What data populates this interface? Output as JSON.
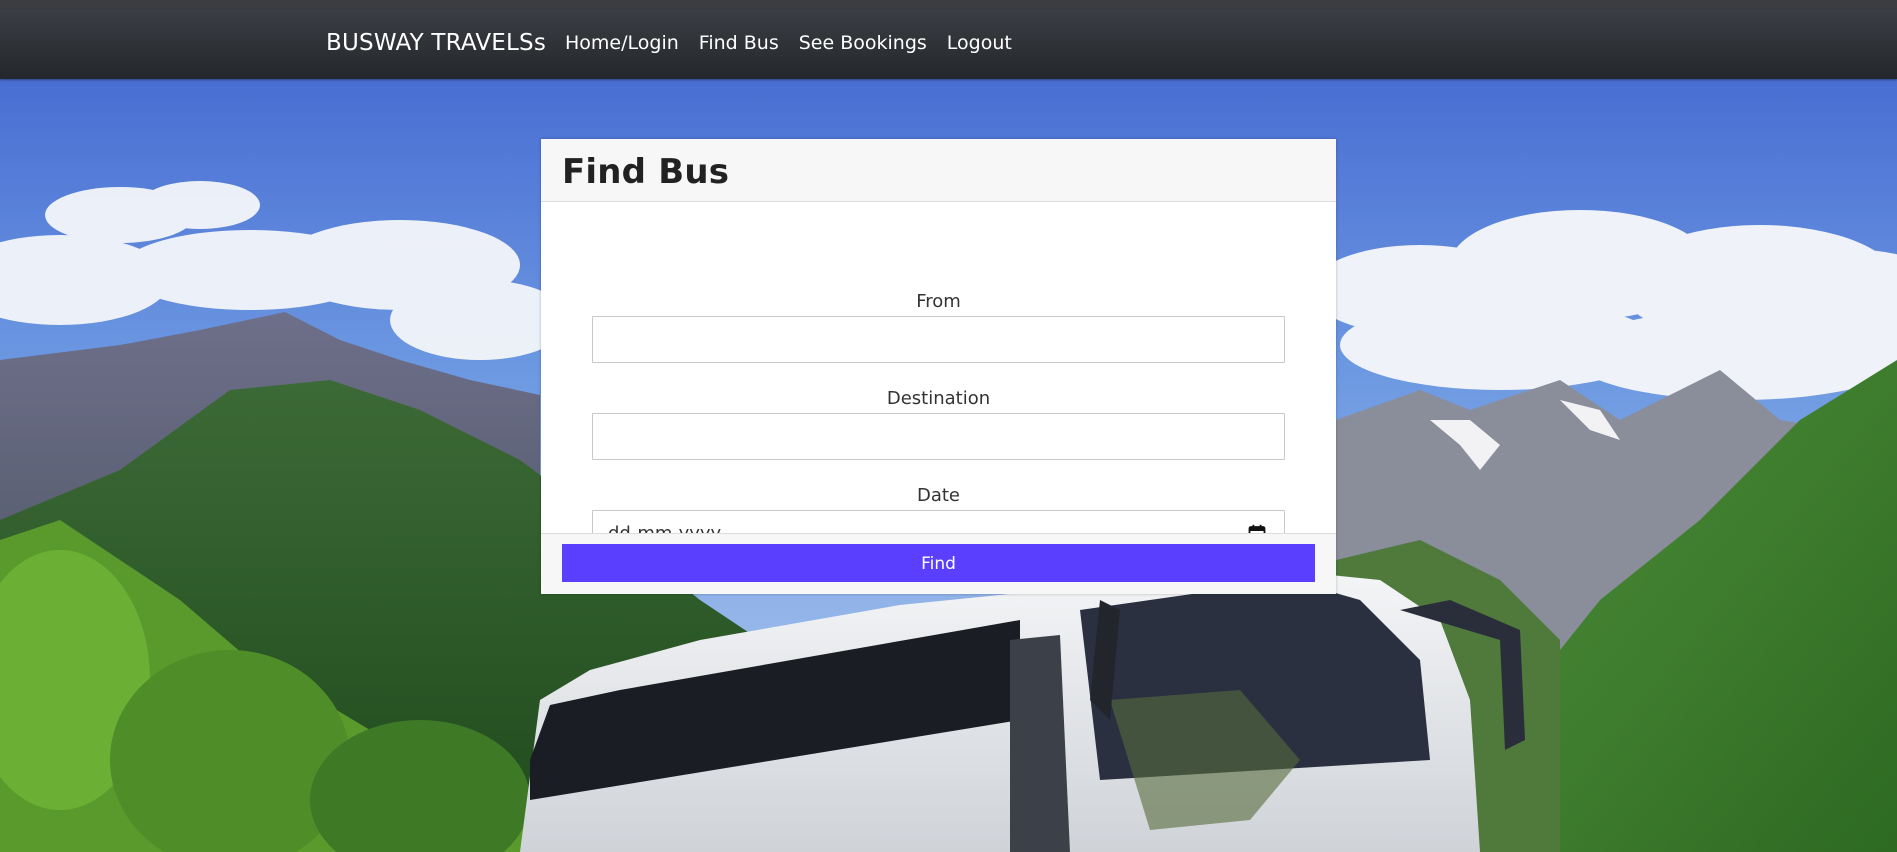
{
  "navbar": {
    "brand": "BUSWAY TRAVELSs",
    "links": [
      "Home/Login",
      "Find Bus",
      "See Bookings",
      "Logout"
    ]
  },
  "form": {
    "title": "Find Bus",
    "fields": {
      "from_label": "From",
      "from_value": "",
      "destination_label": "Destination",
      "destination_value": "",
      "date_label": "Date",
      "date_placeholder": "dd-mm-yyyy"
    },
    "submit_label": "Find"
  },
  "colors": {
    "navbar": "#2f3236",
    "button": "#5b3fff",
    "sky": "#4a7bd8",
    "forest": "#2f6a2a"
  },
  "icons": [
    "calendar-icon"
  ]
}
